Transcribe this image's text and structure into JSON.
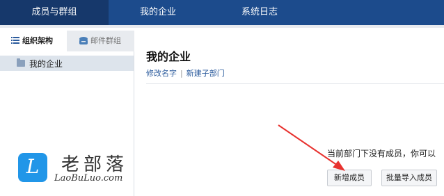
{
  "nav": {
    "tabs": [
      {
        "label": "成员与群组",
        "active": true
      },
      {
        "label": "我的企业",
        "active": false
      },
      {
        "label": "系统日志",
        "active": false
      }
    ]
  },
  "sidebar": {
    "tabs": [
      {
        "label": "组织架构",
        "icon": "list-icon",
        "active": true
      },
      {
        "label": "邮件群组",
        "icon": "mail-group-icon",
        "active": false
      }
    ],
    "tree": [
      {
        "label": "我的企业",
        "icon": "folder-icon",
        "selected": true
      }
    ]
  },
  "main": {
    "title": "我的企业",
    "links": [
      "修改名字",
      "新建子部门"
    ],
    "empty_text": "当前部门下没有成员，你可以",
    "buttons": {
      "add_member": "新增成员",
      "batch_import": "批量导入成员"
    }
  },
  "watermark": {
    "logo_letter": "L",
    "text_cn": "老部落",
    "text_en": "LaoBuLuo.com"
  },
  "colors": {
    "nav_bg": "#1c4b8c",
    "nav_active_bg": "#16386b",
    "link": "#2a5a9c",
    "annotation_arrow": "#e8322f",
    "watermark_logo": "#2196e8"
  }
}
